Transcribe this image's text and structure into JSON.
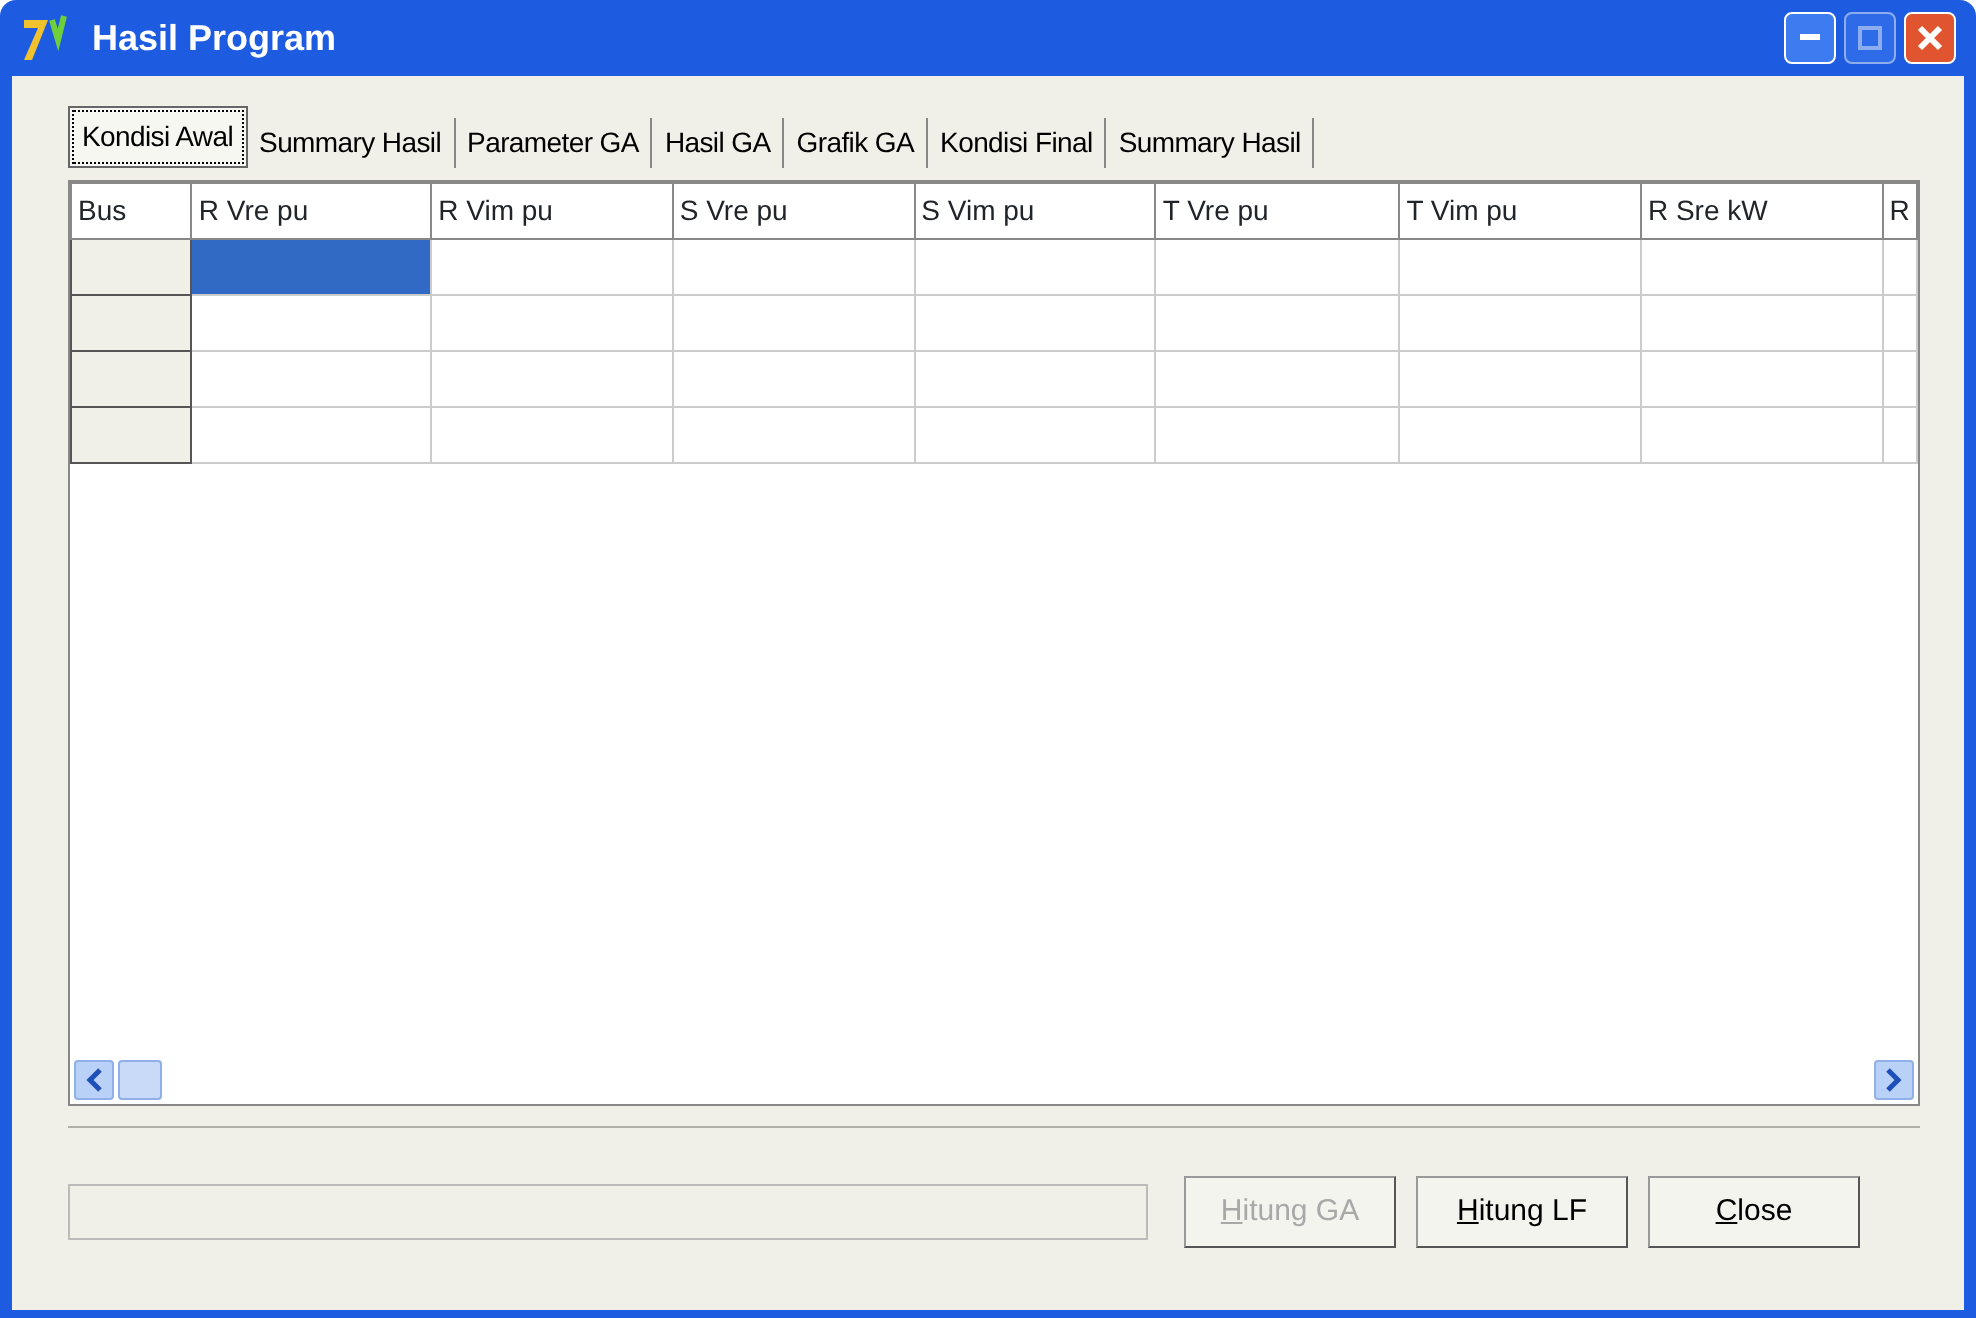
{
  "window": {
    "title": "Hasil Program"
  },
  "tabs": [
    {
      "label": "Kondisi Awal",
      "selected": true
    },
    {
      "label": "Summary Hasil",
      "selected": false
    },
    {
      "label": "Parameter GA",
      "selected": false
    },
    {
      "label": "Hasil GA",
      "selected": false
    },
    {
      "label": "Grafik GA",
      "selected": false
    },
    {
      "label": "Kondisi Final",
      "selected": false
    },
    {
      "label": "Summary Hasil",
      "selected": false
    }
  ],
  "table": {
    "columns": [
      "Bus",
      "R Vre pu",
      "R Vim pu",
      "S Vre pu",
      "S Vim pu",
      "T Vre pu",
      "T Vim pu",
      "R Sre kW",
      "R"
    ],
    "rows": [
      {
        "selected": true
      },
      {
        "selected": false
      },
      {
        "selected": false
      },
      {
        "selected": false
      }
    ]
  },
  "progress": {
    "level": 0
  },
  "buttons": [
    {
      "label": "Hitung GA",
      "disabled": true
    },
    {
      "label": "Hitung LF",
      "disabled": false
    },
    {
      "label": "Close",
      "disabled": false
    }
  ]
}
